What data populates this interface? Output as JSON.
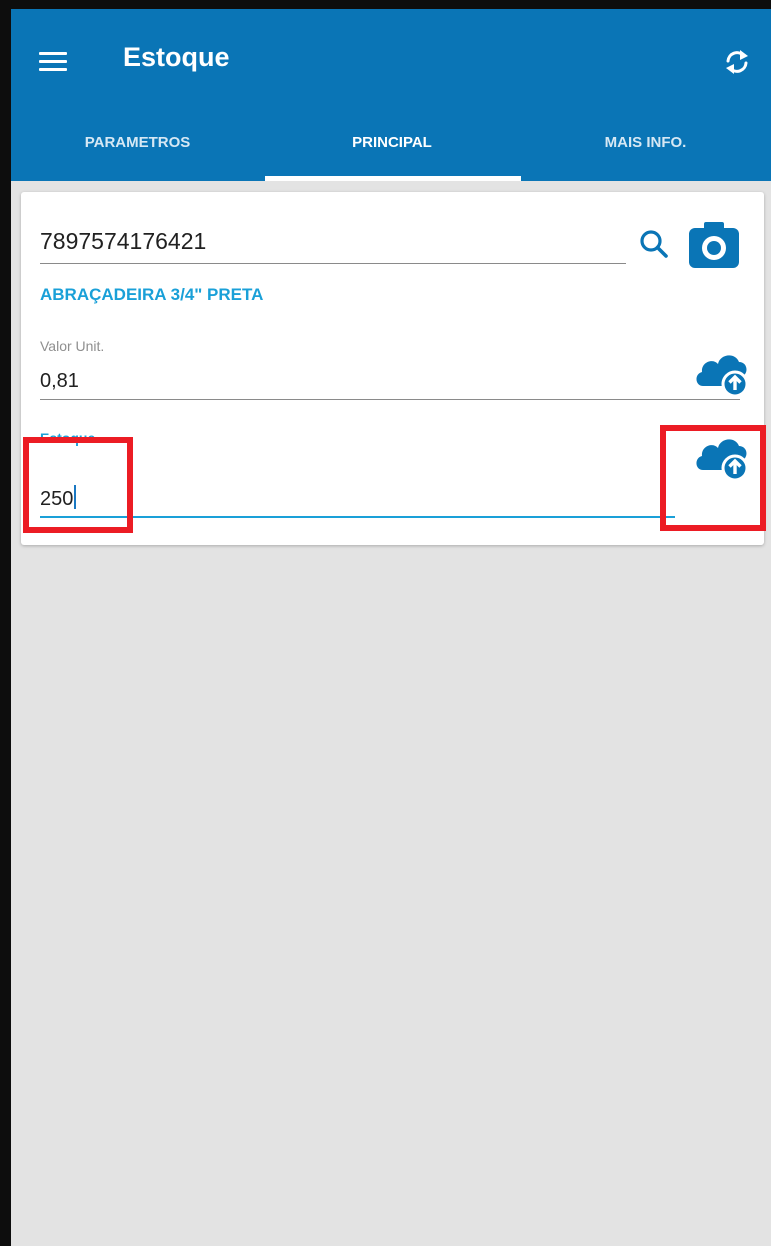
{
  "appbar": {
    "title": "Estoque",
    "menu_icon": "hamburger-menu-icon",
    "sync_icon": "sync-icon",
    "color": "#0a75b6"
  },
  "tabs": [
    {
      "label": "PARAMETROS",
      "active": false
    },
    {
      "label": "PRINCIPAL",
      "active": true
    },
    {
      "label": "MAIS INFO.",
      "active": false
    }
  ],
  "form": {
    "barcode": {
      "value": "7897574176421",
      "search_icon": "search-icon",
      "camera_icon": "camera-icon"
    },
    "product_name": "ABRAÇADEIRA 3/4\" PRETA",
    "valor_unit": {
      "label": "Valor Unit.",
      "value": "0,81",
      "upload_icon": "cloud-upload-icon"
    },
    "estoque": {
      "label": "Estoque",
      "value": "250",
      "upload_icon": "cloud-upload-icon"
    }
  },
  "annotations": {
    "highlight_color": "#ec1c24"
  },
  "colors": {
    "accent": "#1aa0d8",
    "icon_blue": "#0a75b6",
    "background": "#e3e3e3"
  }
}
